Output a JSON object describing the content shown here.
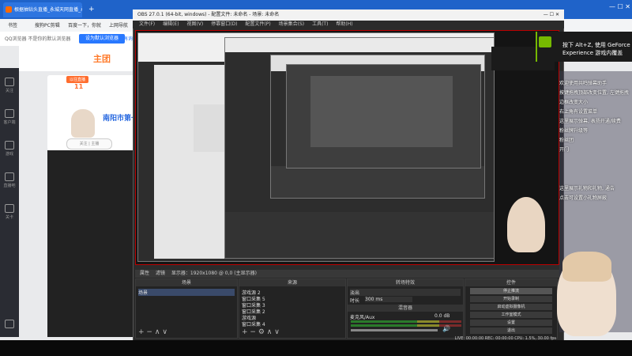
{
  "browser": {
    "tab_title": "根据抽钻头直播_永城天网直播_永...",
    "newtab": "+",
    "bookmarks": [
      "书签",
      "搜狗PC剪辑",
      "百度一下，你就",
      "上网导航"
    ],
    "notice": "QQ浏览器 不是你的默认浏览器",
    "default_btn": "设为默认浏览器",
    "noask_btn": "不再询问",
    "logo": "主团",
    "card_label": "以往直播",
    "card_num": "11",
    "city": "南阳市第一",
    "fans_btn": "关注 | 主播",
    "nav": [
      "关注",
      "客户端",
      "游戏",
      "直播吧",
      "关卡"
    ],
    "window_controls": "—  ☐  ✕"
  },
  "obs": {
    "title": "OBS 27.0.1 (64-bit, windows) - 配置文件: 未命名 - 场景: 未命名",
    "menu": [
      "文件(F)",
      "编辑(E)",
      "视图(V)",
      "停靠窗口(D)",
      "配置文件(P)",
      "场景集合(S)",
      "工具(T)",
      "帮助(H)"
    ],
    "toolbar": [
      "属性",
      "滤镜",
      "显示器：1920x1080 @ 0,0 (主显示器)"
    ],
    "docks": {
      "scenes": "场景",
      "sources": "来源",
      "mixer": "混音器",
      "transition": "转场特效",
      "controls": "控件"
    },
    "scene_list": [
      "场景"
    ],
    "source_list": [
      "游戏源 2",
      "窗口采集 5",
      "窗口采集 3",
      "窗口采集 2",
      "游戏源",
      "窗口采集 4"
    ],
    "transition": {
      "type": "淡出",
      "duration_label": "时长",
      "duration": "300 ms"
    },
    "mixer": {
      "channel": "麦克风/Aux",
      "level": "0.0 dB"
    },
    "controls": [
      "停止推流",
      "开始录制",
      "启动虚拟摄像机",
      "工作室模式",
      "设置",
      "退出"
    ],
    "status": "LIVE: 00:00:00   REC: 00:00:00   CPU: 1.5%, 30.00 fps"
  },
  "geforce": {
    "text": "按下 Alt+Z, 使用 GeForce Experience 游戏内覆盖"
  },
  "chat": [
    "欢迎使用共鸣弹幕助手",
    "按键拖拽顶部改变位置, 左键拖拽",
    "边框改变大小",
    "右上角有设置菜单",
    "这里展示弹幕, 表扬开通/续费",
    "粉丝牌升级等",
    "粉丝团",
    "开门",
    "这里展示礼物和礼物, 通告",
    "点击可设置小礼物屏蔽"
  ],
  "colors": {
    "obs_bg": "#2b2b2b",
    "preview_border": "#b00000",
    "browser_blue": "#1f63c9",
    "nvidia": "#76b900"
  }
}
